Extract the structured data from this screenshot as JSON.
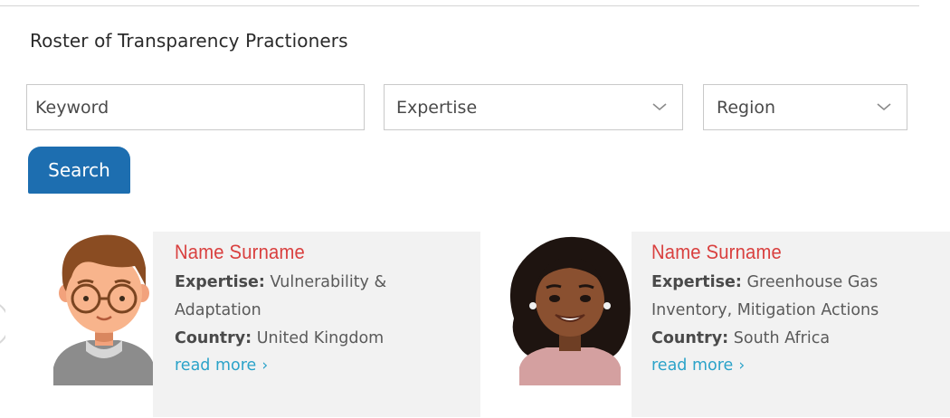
{
  "page": {
    "title": "Roster of Transparency Practioners"
  },
  "filters": {
    "keyword_placeholder": "Keyword",
    "expertise_label": "Expertise",
    "region_label": "Region",
    "search_label": "Search"
  },
  "cards": [
    {
      "name": "Name Surname",
      "expertise_label": "Expertise:",
      "expertise_line1": " Vulnerability &",
      "expertise_line2": "Adaptation",
      "country_label": "Country:",
      "country": " United Kingdom",
      "read_more": "read more"
    },
    {
      "name": "Name Surname",
      "expertise_label": "Expertise:",
      "expertise_line1": " Greenhouse Gas",
      "expertise_line2": "Inventory, Mitigation Actions",
      "country_label": "Country:",
      "country": " South Africa",
      "read_more": "read more"
    }
  ],
  "icons": {
    "dropdown": "chevron-down-icon",
    "read_more": "chevron-right-icon"
  },
  "colors": {
    "name": "#d9403f",
    "link": "#2ba3c9",
    "button": "#1d6eb0",
    "card_bg": "#f2f2f2"
  }
}
